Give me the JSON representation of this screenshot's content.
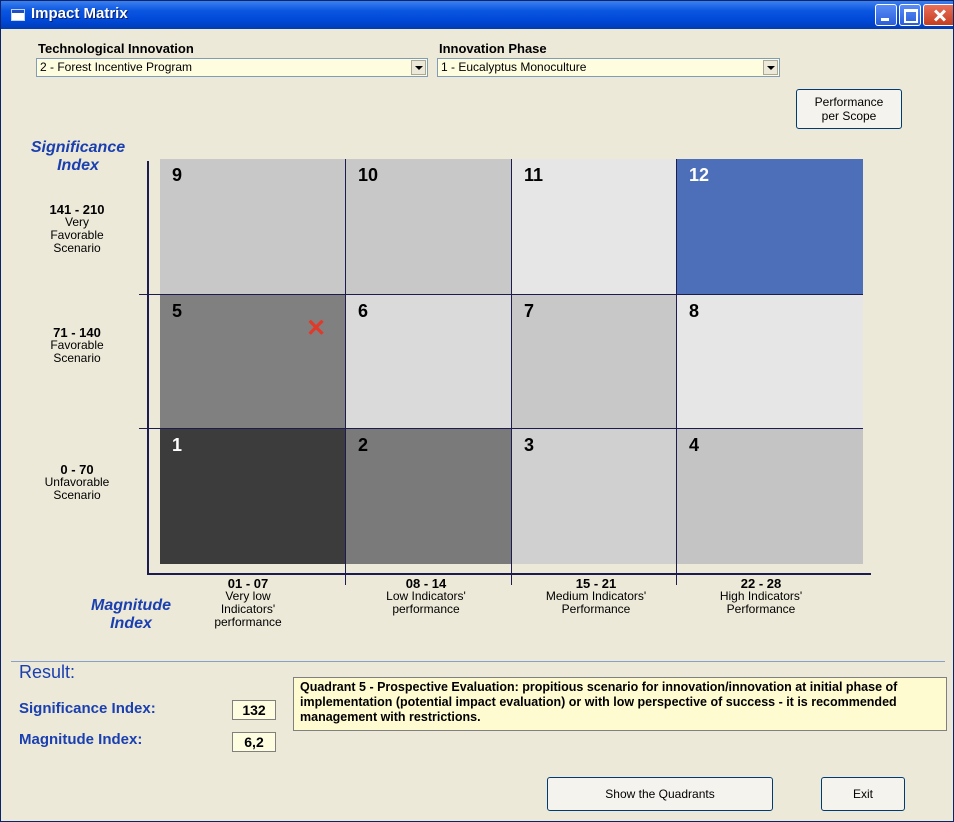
{
  "window": {
    "title": "Impact Matrix"
  },
  "header": {
    "tech_label": "Technological Innovation",
    "tech_value": "2 - Forest Incentive Program",
    "phase_label": "Innovation Phase",
    "phase_value": "1 - Eucalyptus Monoculture",
    "scope_button_line1": "Performance",
    "scope_button_line2": "per Scope"
  },
  "y_axis": {
    "title_line1": "Significance",
    "title_line2": "Index",
    "ranges": [
      {
        "range": "141 - 210",
        "l1": "Very",
        "l2": "Favorable",
        "l3": "Scenario"
      },
      {
        "range": "71 - 140",
        "l1": "Favorable",
        "l2": "Scenario",
        "l3": ""
      },
      {
        "range": "0 - 70",
        "l1": "Unfavorable",
        "l2": "Scenario",
        "l3": ""
      }
    ]
  },
  "x_axis": {
    "title_line1": "Magnitude",
    "title_line2": "Index",
    "ranges": [
      {
        "range": "01 - 07",
        "l1": "Very low",
        "l2": "Indicators'",
        "l3": "performance"
      },
      {
        "range": "08 - 14",
        "l1": "Low Indicators'",
        "l2": "performance",
        "l3": ""
      },
      {
        "range": "15 - 21",
        "l1": "Medium Indicators'",
        "l2": "Performance",
        "l3": ""
      },
      {
        "range": "22 - 28",
        "l1": "High Indicators'",
        "l2": "Performance",
        "l3": ""
      }
    ]
  },
  "matrix": {
    "selected_quadrant": "5",
    "marker_symbol": "✕",
    "cells": [
      {
        "label": "9",
        "color": "#c8c8c8",
        "text_color": "#000000"
      },
      {
        "label": "10",
        "color": "#c8c8c8",
        "text_color": "#000000"
      },
      {
        "label": "11",
        "color": "#e6e6e6",
        "text_color": "#000000"
      },
      {
        "label": "12",
        "color": "#4d6eb8",
        "text_color": "#ffffff"
      },
      {
        "label": "5",
        "color": "#808080",
        "text_color": "#000000"
      },
      {
        "label": "6",
        "color": "#dadada",
        "text_color": "#000000"
      },
      {
        "label": "7",
        "color": "#c8c8c8",
        "text_color": "#000000"
      },
      {
        "label": "8",
        "color": "#e6e6e6",
        "text_color": "#000000"
      },
      {
        "label": "1",
        "color": "#3c3c3c",
        "text_color": "#ffffff"
      },
      {
        "label": "2",
        "color": "#7a7a7a",
        "text_color": "#000000"
      },
      {
        "label": "3",
        "color": "#d0d0d0",
        "text_color": "#000000"
      },
      {
        "label": "4",
        "color": "#c4c4c4",
        "text_color": "#000000"
      }
    ]
  },
  "result": {
    "title": "Result:",
    "significance_label": "Significance Index:",
    "significance_value": "132",
    "magnitude_label": "Magnitude Index:",
    "magnitude_value": "6,2",
    "description": "Quadrant 5 - Prospective Evaluation: propitious scenario for innovation/innovation at initial phase of implementation (potential impact evaluation) or with low perspective of success - it is recommended management with restrictions."
  },
  "footer": {
    "show_quadrants_label": "Show the Quadrants",
    "exit_label": "Exit"
  }
}
